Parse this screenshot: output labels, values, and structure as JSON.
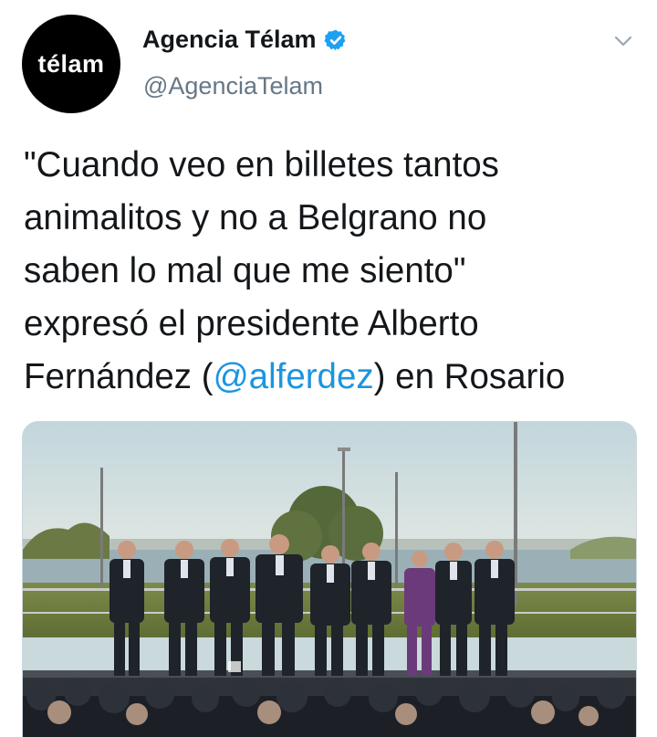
{
  "tweet": {
    "avatar_text": "télam",
    "display_name": "Agencia Télam",
    "handle": "@AgenciaTelam",
    "text_before": "\"Cuando veo en billetes tantos\nanimalitos y no a Belgrano no\nsaben lo mal que me siento\"\nexpresó el presidente Alberto\nFernández (",
    "mention": "@alferdez",
    "text_after": ") en Rosario"
  },
  "icons": {
    "verified": "verified-badge-icon",
    "menu": "chevron-down-icon"
  },
  "colors": {
    "accent": "#1b95e0",
    "handle": "#657786",
    "text": "#14171a"
  }
}
